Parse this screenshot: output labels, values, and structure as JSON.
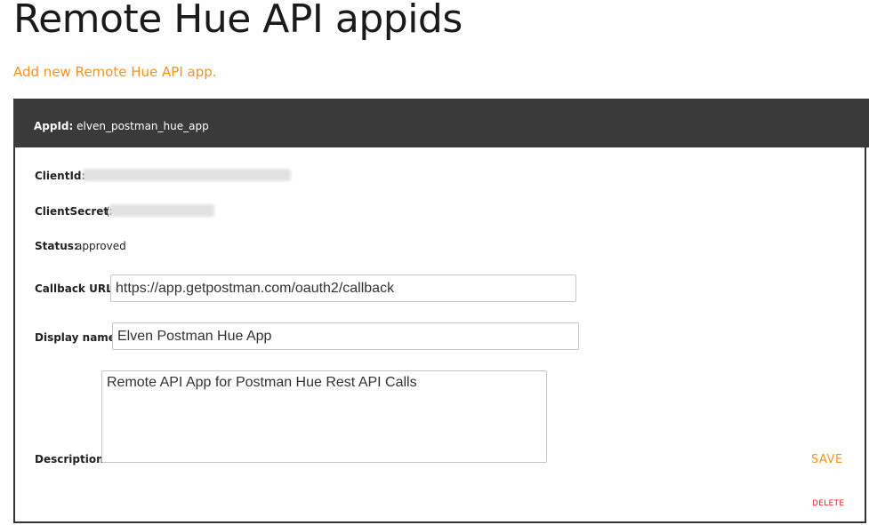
{
  "page": {
    "title": "Remote Hue API appids",
    "add_link": "Add new Remote Hue API app."
  },
  "app": {
    "appid_label": "AppId:",
    "appid_value": "elven_postman_hue_app",
    "clientid_label": "ClientId:",
    "clientsecret_label": "ClientSecret:",
    "clientsecret_visible_prefix": "(",
    "status_label": "Status:",
    "status_value": "approved",
    "callback_label": "Callback URL:",
    "callback_value": "https://app.getpostman.com/oauth2/callback",
    "displayname_label": "Display name:",
    "displayname_value": "Elven Postman Hue App",
    "description_label": "Description:",
    "description_value": "Remote API App for Postman Hue Rest API Calls",
    "save_label": "SAVE",
    "delete_label": "DELETE"
  },
  "colors": {
    "accent": "#f39324",
    "header_bg": "#3a3a3a",
    "delete": "#dd2222"
  }
}
